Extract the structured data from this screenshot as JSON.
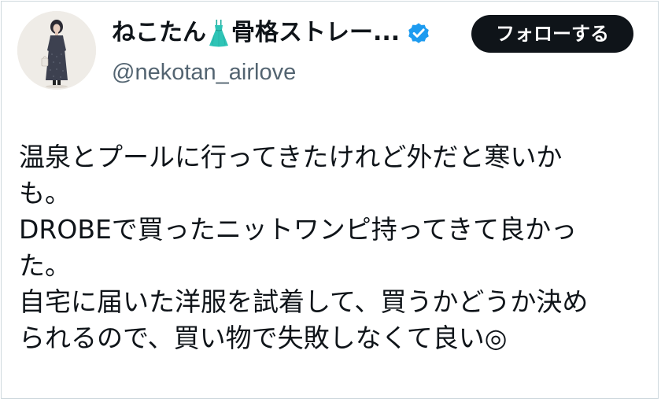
{
  "author": {
    "display_name_part1": "ねこたん",
    "display_name_part2": "骨格ストレー...",
    "name_emoji": "dress-icon",
    "verified": true,
    "verified_icon": "verified-badge-icon",
    "handle": "@nekotan_airlove"
  },
  "follow_button": {
    "label": "フォローする"
  },
  "tweet": {
    "lines": [
      "温泉とプールに行ってきたけれど外だと寒いか",
      "も。",
      "DROBEで買ったニットワンピ持ってきて良かっ",
      "た。",
      "自宅に届いた洋服を試着して、買うかどうか決め",
      "られるので、買い物で失敗しなくて良い◎"
    ]
  },
  "colors": {
    "text": "#0f1419",
    "secondary_text": "#536471",
    "verified_blue": "#1d9bf0",
    "dress_teal": "#2ec4b6",
    "button_bg": "#0f1419",
    "button_text": "#ffffff",
    "border": "#cfd9de"
  }
}
